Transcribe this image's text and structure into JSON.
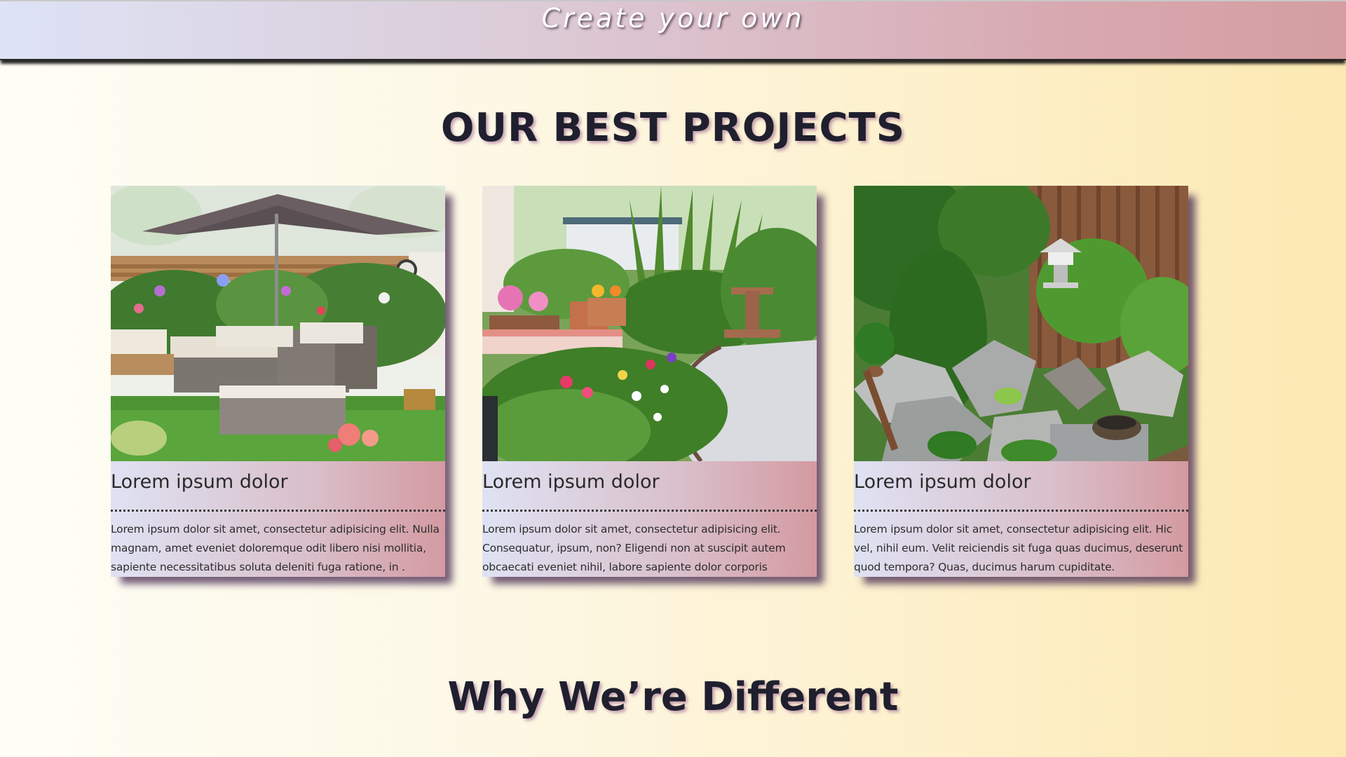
{
  "header": {
    "banner_text": "Create your own"
  },
  "projects_section": {
    "title": "OUR BEST PROJECTS",
    "cards": [
      {
        "title": "Lorem ipsum dolor",
        "text": "Lorem ipsum dolor sit amet, consectetur adipisicing elit. Nulla magnam, amet eveniet doloremque odit libero nisi mollitia, sapiente necessitatibus soluta deleniti fuga ratione, in .",
        "image": "patio-garden-with-umbrella-and-wicker-sofa"
      },
      {
        "title": "Lorem ipsum dolor",
        "text": "Lorem ipsum dolor sit amet, consectetur adipisicing elit. Consequatur, ipsum, non? Eligendi non at suscipit autem obcaecati eveniet nihil, labore sapiente dolor corporis",
        "image": "curved-garden-path-with-flower-beds"
      },
      {
        "title": "Lorem ipsum dolor",
        "text": "Lorem ipsum dolor sit amet, consectetur adipisicing elit. Hic vel, nihil eum. Velit reiciendis sit fuga quas ducimus, deserunt quod tempora? Quas, ducimus harum cupiditate.",
        "image": "japanese-rock-garden-with-stone-lantern"
      }
    ]
  },
  "different_section": {
    "title": "Why We’re Different"
  },
  "colors": {
    "banner_start": "#dde3f6",
    "banner_end": "#d49ea1",
    "page_bg_start": "#fffef6",
    "page_bg_end": "#fce9b2",
    "heading": "#1f1f2e"
  }
}
